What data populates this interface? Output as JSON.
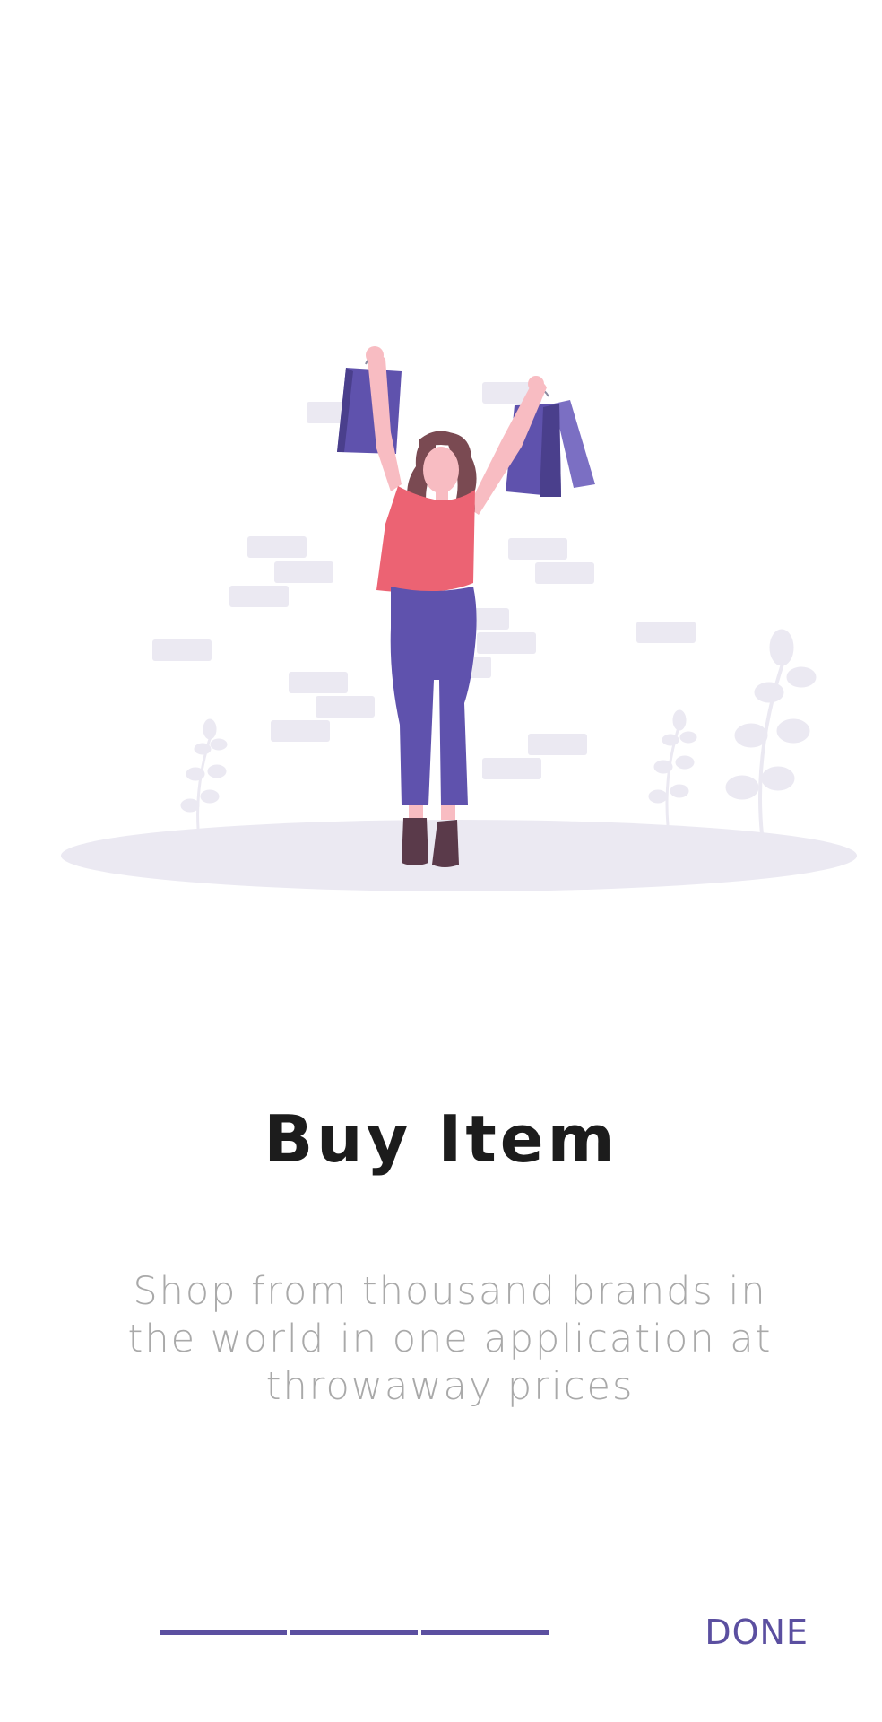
{
  "onboarding": {
    "title": "Buy Item",
    "description": "Shop from thousand brands in the world in one application at throwaway prices",
    "done_label": "DONE",
    "progress_steps": 3,
    "progress_completed": 3
  },
  "colors": {
    "accent": "#5b4fa0",
    "title": "#1c1c1c",
    "description": "#a9a9a9",
    "shirt": "#ec6373",
    "pants": "#5f52ad",
    "hair": "#7a4a52",
    "skin": "#f8bcc2",
    "ground": "#ebe9f2",
    "bricks": "#ebe9f2"
  },
  "illustration": {
    "subject": "woman-with-shopping-bags"
  }
}
